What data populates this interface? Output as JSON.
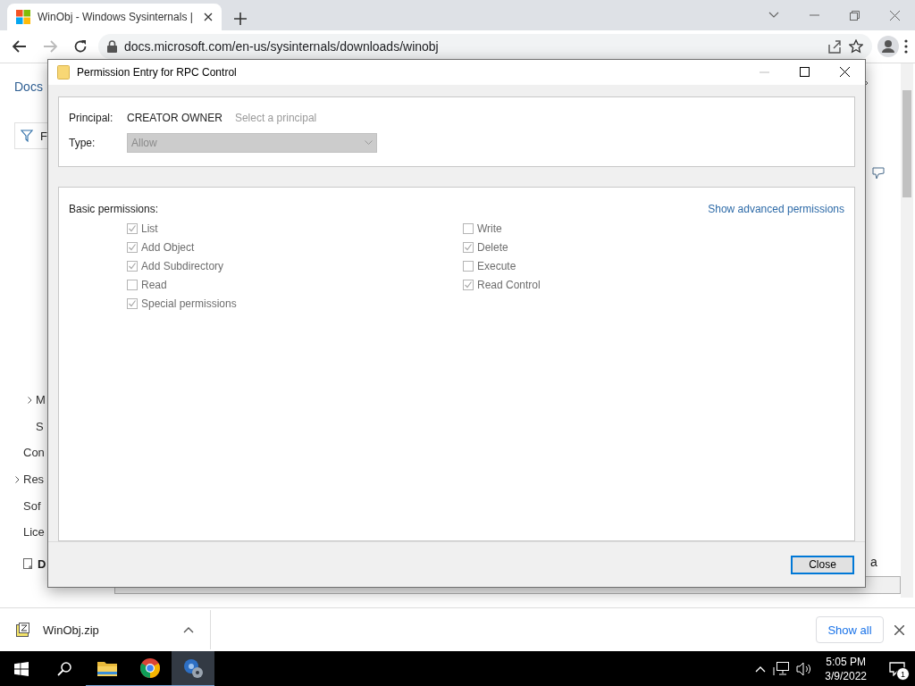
{
  "browser": {
    "tab": {
      "title": "WinObj - Windows Sysinternals |",
      "selected": true
    },
    "address": "docs.microsoft.com/en-us/sysinternals/downloads/winobj"
  },
  "page": {
    "header_link": "Docs",
    "filter_fragment": "F",
    "sidebar": [
      {
        "text": "M",
        "expandable": true,
        "nested": true
      },
      {
        "text": "S",
        "expandable": false,
        "nested": true
      },
      {
        "text": "Con",
        "expandable": false,
        "nested": false
      },
      {
        "text": "Res",
        "expandable": true,
        "nested": false
      },
      {
        "text": "Sof",
        "expandable": false,
        "nested": false
      },
      {
        "text": "Lice",
        "expandable": false,
        "nested": false
      }
    ],
    "download_link": "D",
    "right_fragment": "a"
  },
  "dialog": {
    "title": "Permission Entry for RPC Control",
    "principal_label": "Principal:",
    "principal": "CREATOR OWNER",
    "principal_link": "Select a principal",
    "type_label": "Type:",
    "type_value": "Allow",
    "type_disabled": true,
    "permissions_label": "Basic permissions:",
    "advanced_link": "Show advanced permissions",
    "left_permissions": [
      {
        "label": "List",
        "checked": true,
        "disabled": true
      },
      {
        "label": "Add Object",
        "checked": true,
        "disabled": true
      },
      {
        "label": "Add Subdirectory",
        "checked": true,
        "disabled": true
      },
      {
        "label": "Read",
        "checked": false,
        "disabled": true
      },
      {
        "label": "Special permissions",
        "checked": true,
        "disabled": true
      }
    ],
    "right_permissions": [
      {
        "label": "Write",
        "checked": false,
        "disabled": true
      },
      {
        "label": "Delete",
        "checked": true,
        "disabled": true
      },
      {
        "label": "Execute",
        "checked": false,
        "disabled": true
      },
      {
        "label": "Read Control",
        "checked": true,
        "disabled": true
      }
    ],
    "close_button": "Close"
  },
  "downloads": {
    "file": "WinObj.zip",
    "show_all": "Show all"
  },
  "taskbar": {
    "apps": [
      {
        "kind": "explorer",
        "selected": false
      },
      {
        "kind": "chrome",
        "selected": false
      },
      {
        "kind": "gears",
        "selected": true
      }
    ],
    "time": "5:05 PM",
    "date": "3/9/2022",
    "notifications": "1"
  }
}
